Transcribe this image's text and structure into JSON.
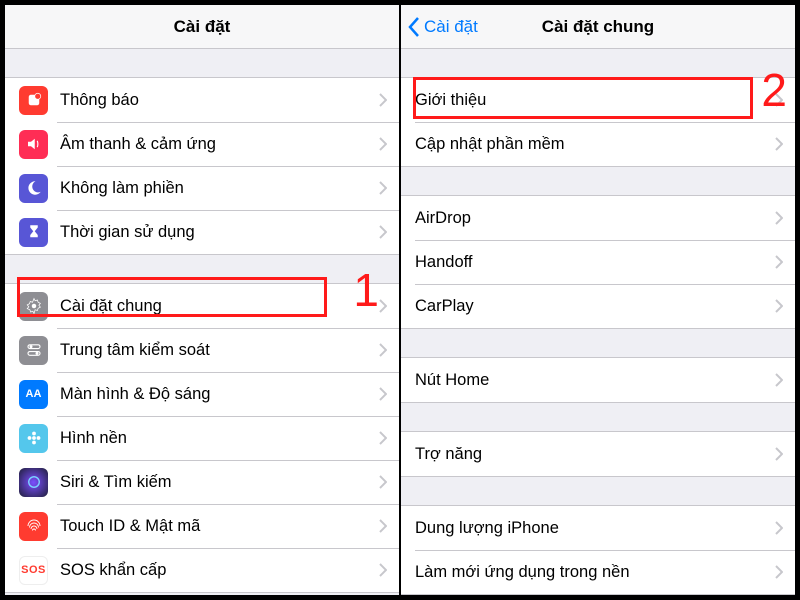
{
  "left": {
    "title": "Cài đặt",
    "items": [
      {
        "label": "Thông báo",
        "icon": "notify"
      },
      {
        "label": "Âm thanh & cảm ứng",
        "icon": "sound"
      },
      {
        "label": "Không làm phiền",
        "icon": "dnd"
      },
      {
        "label": "Thời gian sử dụng",
        "icon": "screen"
      },
      {
        "label": "Cài đặt chung",
        "icon": "general"
      },
      {
        "label": "Trung tâm kiểm soát",
        "icon": "control"
      },
      {
        "label": "Màn hình & Độ sáng",
        "icon": "display"
      },
      {
        "label": "Hình nền",
        "icon": "wall"
      },
      {
        "label": "Siri & Tìm kiếm",
        "icon": "siri"
      },
      {
        "label": "Touch ID & Mật mã",
        "icon": "touchid"
      },
      {
        "label": "SOS khẩn cấp",
        "icon": "sos"
      }
    ]
  },
  "right": {
    "back": "Cài đặt",
    "title": "Cài đặt chung",
    "groups": [
      [
        "Giới thiệu",
        "Cập nhật phần mềm"
      ],
      [
        "AirDrop",
        "Handoff",
        "CarPlay"
      ],
      [
        "Nút Home"
      ],
      [
        "Trợ năng"
      ],
      [
        "Dung lượng iPhone",
        "Làm mới ứng dụng trong nền"
      ]
    ]
  },
  "annotations": {
    "step1": "1",
    "step2": "2"
  }
}
